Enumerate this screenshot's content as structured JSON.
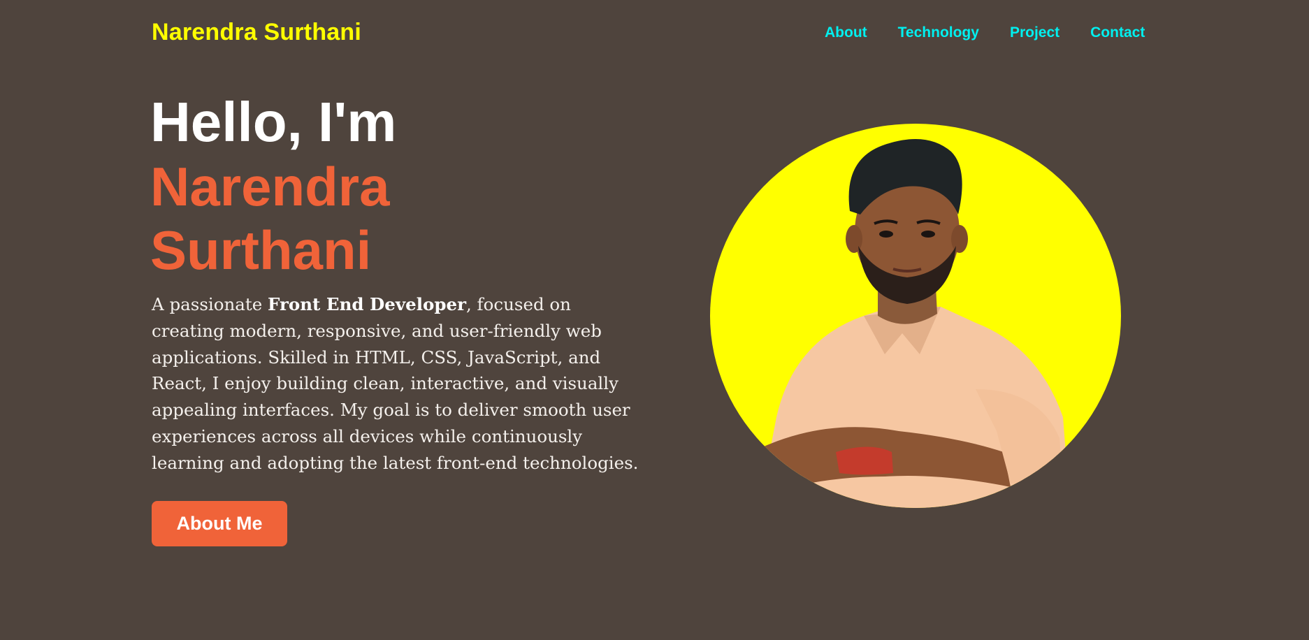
{
  "header": {
    "brand": "Narendra Surthani",
    "nav": [
      {
        "label": "About"
      },
      {
        "label": "Technology"
      },
      {
        "label": "Project"
      },
      {
        "label": "Contact"
      }
    ]
  },
  "hero": {
    "greeting": "Hello, I'm",
    "name_line1": "Narendra",
    "name_line2": "Surthani",
    "bio_prefix": "A passionate ",
    "bio_highlight": "Front End Developer",
    "bio_suffix": ", focused on creating modern, responsive, and user-friendly web applications. Skilled in HTML, CSS, JavaScript, and React, I enjoy building clean, interactive, and visually appealing interfaces. My goal is to deliver smooth user experiences across all devices while continuously learning and adopting the latest front-end technologies.",
    "cta_label": "About Me"
  },
  "colors": {
    "background": "#4f443d",
    "brand": "#ffff00",
    "nav": "#00f0f0",
    "accent": "#f06339",
    "portrait_bg": "#ffff00"
  },
  "portrait": {
    "icon": "profile-photo"
  }
}
